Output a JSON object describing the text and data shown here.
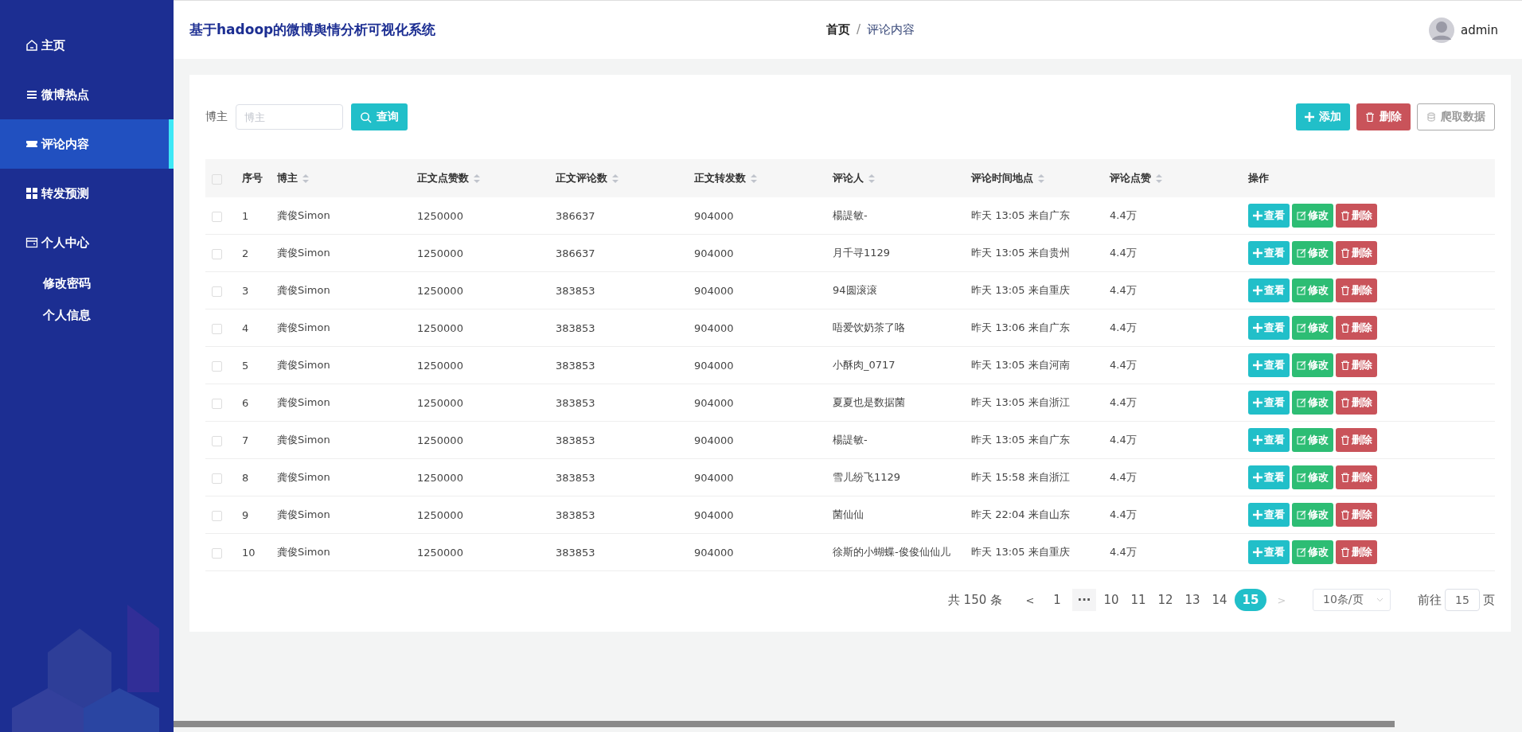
{
  "sidebar": {
    "items": [
      {
        "label": "主页",
        "selected": false
      },
      {
        "label": "微博热点",
        "selected": false
      },
      {
        "label": "评论内容",
        "selected": true
      },
      {
        "label": "转发预测",
        "selected": false
      },
      {
        "label": "个人中心",
        "selected": false,
        "children": [
          {
            "label": "修改密码",
            "selected": false
          },
          {
            "label": "个人信息",
            "selected": false
          }
        ]
      }
    ]
  },
  "header": {
    "title": "基于hadoop的微博舆情分析可视化系统",
    "breadcrumb": [
      "首页",
      "评论内容"
    ],
    "breadcrumb_separator": "/",
    "user": "admin"
  },
  "search": {
    "label": "博主",
    "placeholder": "博主",
    "button": "查询"
  },
  "toolbar": [
    {
      "label": "添加",
      "kind": "add"
    },
    {
      "label": "删除",
      "kind": "delete"
    },
    {
      "label": "爬取数据",
      "kind": "crawl"
    }
  ],
  "table": {
    "select_all": {
      "checked": false
    },
    "columns": [
      {
        "label": "序号",
        "sortable": false
      },
      {
        "label": "博主",
        "sortable": true
      },
      {
        "label": "正文点赞数",
        "sortable": true
      },
      {
        "label": "正文评论数",
        "sortable": true
      },
      {
        "label": "正文转发数",
        "sortable": true
      },
      {
        "label": "评论人",
        "sortable": true
      },
      {
        "label": "评论时间地点",
        "sortable": true
      },
      {
        "label": "评论点赞",
        "sortable": true
      },
      {
        "label": "操作",
        "sortable": false
      }
    ],
    "rows": [
      {
        "checked": false,
        "cells": [
          "1",
          "龚俊Simon",
          "1250000",
          "386637",
          "904000",
          "楊諟敏-",
          "昨天 13:05 来自广东",
          "4.4万"
        ],
        "actions": [
          {
            "label": "查看",
            "kind": "view"
          },
          {
            "label": "修改",
            "kind": "edit"
          },
          {
            "label": "删除",
            "kind": "delete"
          }
        ]
      },
      {
        "checked": false,
        "cells": [
          "2",
          "龚俊Simon",
          "1250000",
          "386637",
          "904000",
          "月千寻1129",
          "昨天 13:05 来自贵州",
          "4.4万"
        ],
        "actions": [
          {
            "label": "查看",
            "kind": "view"
          },
          {
            "label": "修改",
            "kind": "edit"
          },
          {
            "label": "删除",
            "kind": "delete"
          }
        ]
      },
      {
        "checked": false,
        "cells": [
          "3",
          "龚俊Simon",
          "1250000",
          "383853",
          "904000",
          "94圆滚滚",
          "昨天 13:05 来自重庆",
          "4.4万"
        ],
        "actions": [
          {
            "label": "查看",
            "kind": "view"
          },
          {
            "label": "修改",
            "kind": "edit"
          },
          {
            "label": "删除",
            "kind": "delete"
          }
        ]
      },
      {
        "checked": false,
        "cells": [
          "4",
          "龚俊Simon",
          "1250000",
          "383853",
          "904000",
          "唔爱饮奶茶了咯",
          "昨天 13:06 来自广东",
          "4.4万"
        ],
        "actions": [
          {
            "label": "查看",
            "kind": "view"
          },
          {
            "label": "修改",
            "kind": "edit"
          },
          {
            "label": "删除",
            "kind": "delete"
          }
        ]
      },
      {
        "checked": false,
        "cells": [
          "5",
          "龚俊Simon",
          "1250000",
          "383853",
          "904000",
          "小酥肉_0717",
          "昨天 13:05 来自河南",
          "4.4万"
        ],
        "actions": [
          {
            "label": "查看",
            "kind": "view"
          },
          {
            "label": "修改",
            "kind": "edit"
          },
          {
            "label": "删除",
            "kind": "delete"
          }
        ]
      },
      {
        "checked": false,
        "cells": [
          "6",
          "龚俊Simon",
          "1250000",
          "383853",
          "904000",
          "夏夏也是数据菌",
          "昨天 13:05 来自浙江",
          "4.4万"
        ],
        "actions": [
          {
            "label": "查看",
            "kind": "view"
          },
          {
            "label": "修改",
            "kind": "edit"
          },
          {
            "label": "删除",
            "kind": "delete"
          }
        ]
      },
      {
        "checked": false,
        "cells": [
          "7",
          "龚俊Simon",
          "1250000",
          "383853",
          "904000",
          "楊諟敏-",
          "昨天 13:05 来自广东",
          "4.4万"
        ],
        "actions": [
          {
            "label": "查看",
            "kind": "view"
          },
          {
            "label": "修改",
            "kind": "edit"
          },
          {
            "label": "删除",
            "kind": "delete"
          }
        ]
      },
      {
        "checked": false,
        "cells": [
          "8",
          "龚俊Simon",
          "1250000",
          "383853",
          "904000",
          "雪儿纷飞1129",
          "昨天 15:58 来自浙江",
          "4.4万"
        ],
        "actions": [
          {
            "label": "查看",
            "kind": "view"
          },
          {
            "label": "修改",
            "kind": "edit"
          },
          {
            "label": "删除",
            "kind": "delete"
          }
        ]
      },
      {
        "checked": false,
        "cells": [
          "9",
          "龚俊Simon",
          "1250000",
          "383853",
          "904000",
          "菌仙仙",
          "昨天 22:04 来自山东",
          "4.4万"
        ],
        "actions": [
          {
            "label": "查看",
            "kind": "view"
          },
          {
            "label": "修改",
            "kind": "edit"
          },
          {
            "label": "删除",
            "kind": "delete"
          }
        ]
      },
      {
        "checked": false,
        "cells": [
          "10",
          "龚俊Simon",
          "1250000",
          "383853",
          "904000",
          "徐斯的小蝴蝶-俊俊仙仙儿",
          "昨天 13:05 来自重庆",
          "4.4万"
        ],
        "actions": [
          {
            "label": "查看",
            "kind": "view"
          },
          {
            "label": "修改",
            "kind": "edit"
          },
          {
            "label": "删除",
            "kind": "delete"
          }
        ]
      }
    ]
  },
  "pagination": {
    "total": "共 150 条",
    "prev": {
      "label": "<",
      "disabled": false
    },
    "pages": [
      {
        "label": "1",
        "kind": "page",
        "selected": false
      },
      {
        "label": "···",
        "kind": "more",
        "selected": false
      },
      {
        "label": "10",
        "kind": "page",
        "selected": false
      },
      {
        "label": "11",
        "kind": "page",
        "selected": false
      },
      {
        "label": "12",
        "kind": "page",
        "selected": false
      },
      {
        "label": "13",
        "kind": "page",
        "selected": false
      },
      {
        "label": "14",
        "kind": "page",
        "selected": false
      },
      {
        "label": "15",
        "kind": "page",
        "selected": true
      }
    ],
    "next": {
      "label": ">",
      "disabled": true
    },
    "page_size": "10条/页",
    "goto_label": "前往",
    "goto_value": "15",
    "goto_suffix": "页"
  }
}
